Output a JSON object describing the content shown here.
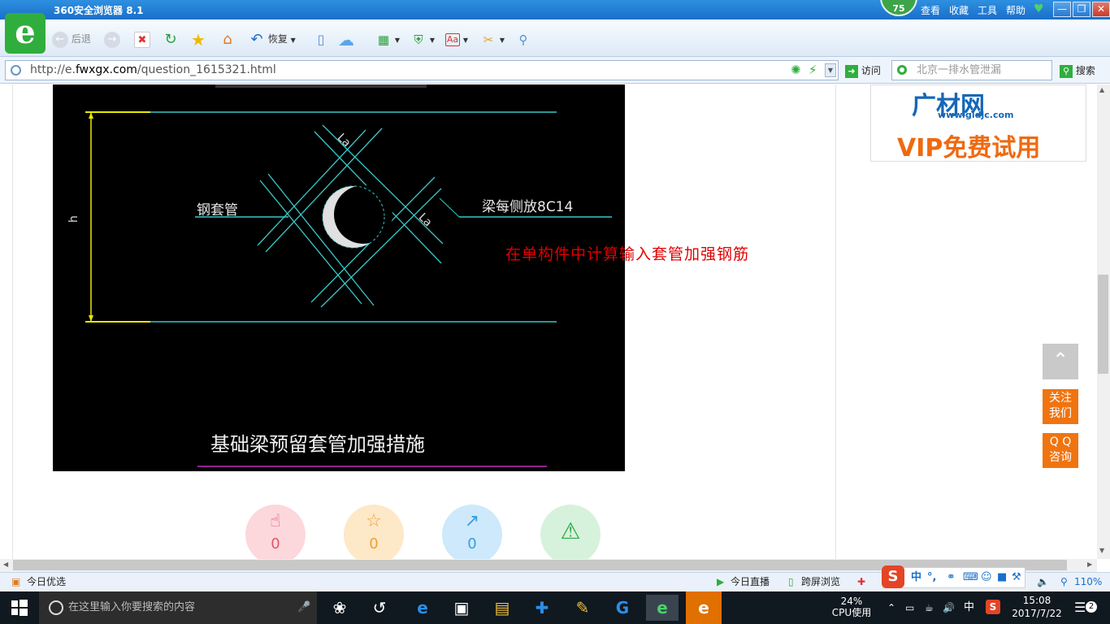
{
  "window": {
    "title": "360安全浏览器 8.1",
    "score": "75",
    "menu": [
      "查看",
      "收藏",
      "工具",
      "帮助"
    ]
  },
  "toolbar": {
    "back_label": "后退",
    "restore_label": "恢复"
  },
  "address": {
    "url_prefix": "http://e.",
    "url_domain": "fwxgx.com",
    "url_path": "/question_1615321.html",
    "go_label": "访问",
    "search_placeholder": "北京一排水管泄漏",
    "search_label": "搜索"
  },
  "diagram": {
    "h_label": "h",
    "la_top": "La",
    "la_right": "La",
    "sleeve_label": "钢套管",
    "beam_label": "梁每侧放8C14",
    "caption": "基础梁预留套管加强措施"
  },
  "content": {
    "red_note": "在单构件中计算输入套管加强钢筋"
  },
  "ad": {
    "brand": "广材网",
    "url": "www.gldjc.com",
    "promo": "VIP免费试用"
  },
  "actions": [
    {
      "name": "like",
      "count": "0",
      "icon": "thumbs-up-icon",
      "bg": "#fcd7dc",
      "fg": "#e0586d"
    },
    {
      "name": "favorite",
      "count": "0",
      "icon": "star-icon",
      "bg": "#fde8c8",
      "fg": "#f0a030"
    },
    {
      "name": "share",
      "count": "0",
      "icon": "share-icon",
      "bg": "#cde9fb",
      "fg": "#3a9ee0"
    },
    {
      "name": "report",
      "count": "",
      "icon": "warning-icon",
      "bg": "#d7f2dc",
      "fg": "#30a84a"
    }
  ],
  "sidebar": {
    "follow_line1": "关注",
    "follow_line2": "我们",
    "qq_line1": "Q Q",
    "qq_line2": "咨询"
  },
  "statusbar": {
    "today_pick": "今日优选",
    "today_live": "今日直播",
    "cross_screen": "跨屏浏览",
    "zoom": "110%"
  },
  "ime": {
    "mode": "中",
    "punct": "°,"
  },
  "taskbar": {
    "search_placeholder": "在这里输入你要搜索的内容",
    "cpu_percent": "24%",
    "cpu_label": "CPU使用",
    "lang": "中",
    "time": "15:08",
    "date": "2017/7/22",
    "notif_count": "2"
  }
}
